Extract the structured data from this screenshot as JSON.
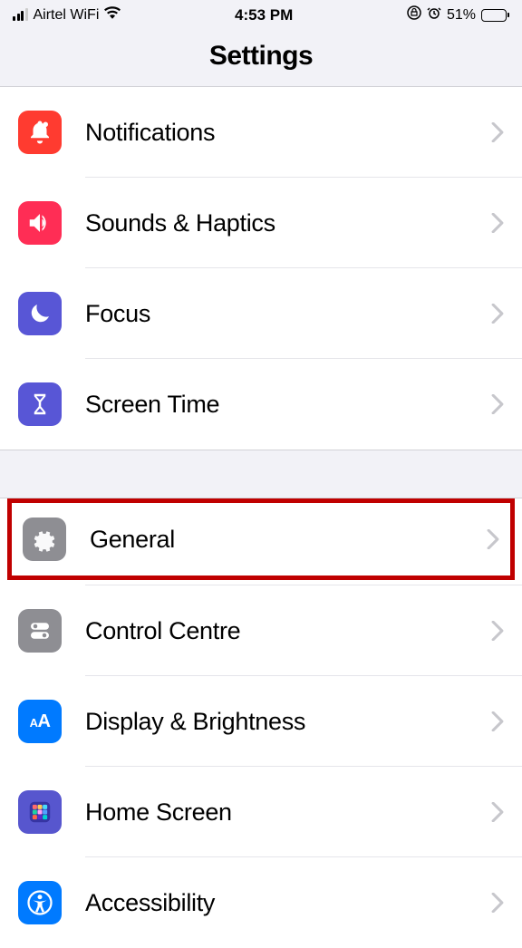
{
  "status": {
    "carrier": "Airtel WiFi",
    "time": "4:53 PM",
    "battery_pct": "51%"
  },
  "header": {
    "title": "Settings"
  },
  "section1": {
    "items": [
      {
        "label": "Notifications"
      },
      {
        "label": "Sounds & Haptics"
      },
      {
        "label": "Focus"
      },
      {
        "label": "Screen Time"
      }
    ]
  },
  "section2": {
    "items": [
      {
        "label": "General"
      },
      {
        "label": "Control Centre"
      },
      {
        "label": "Display & Brightness"
      },
      {
        "label": "Home Screen"
      },
      {
        "label": "Accessibility"
      }
    ]
  }
}
